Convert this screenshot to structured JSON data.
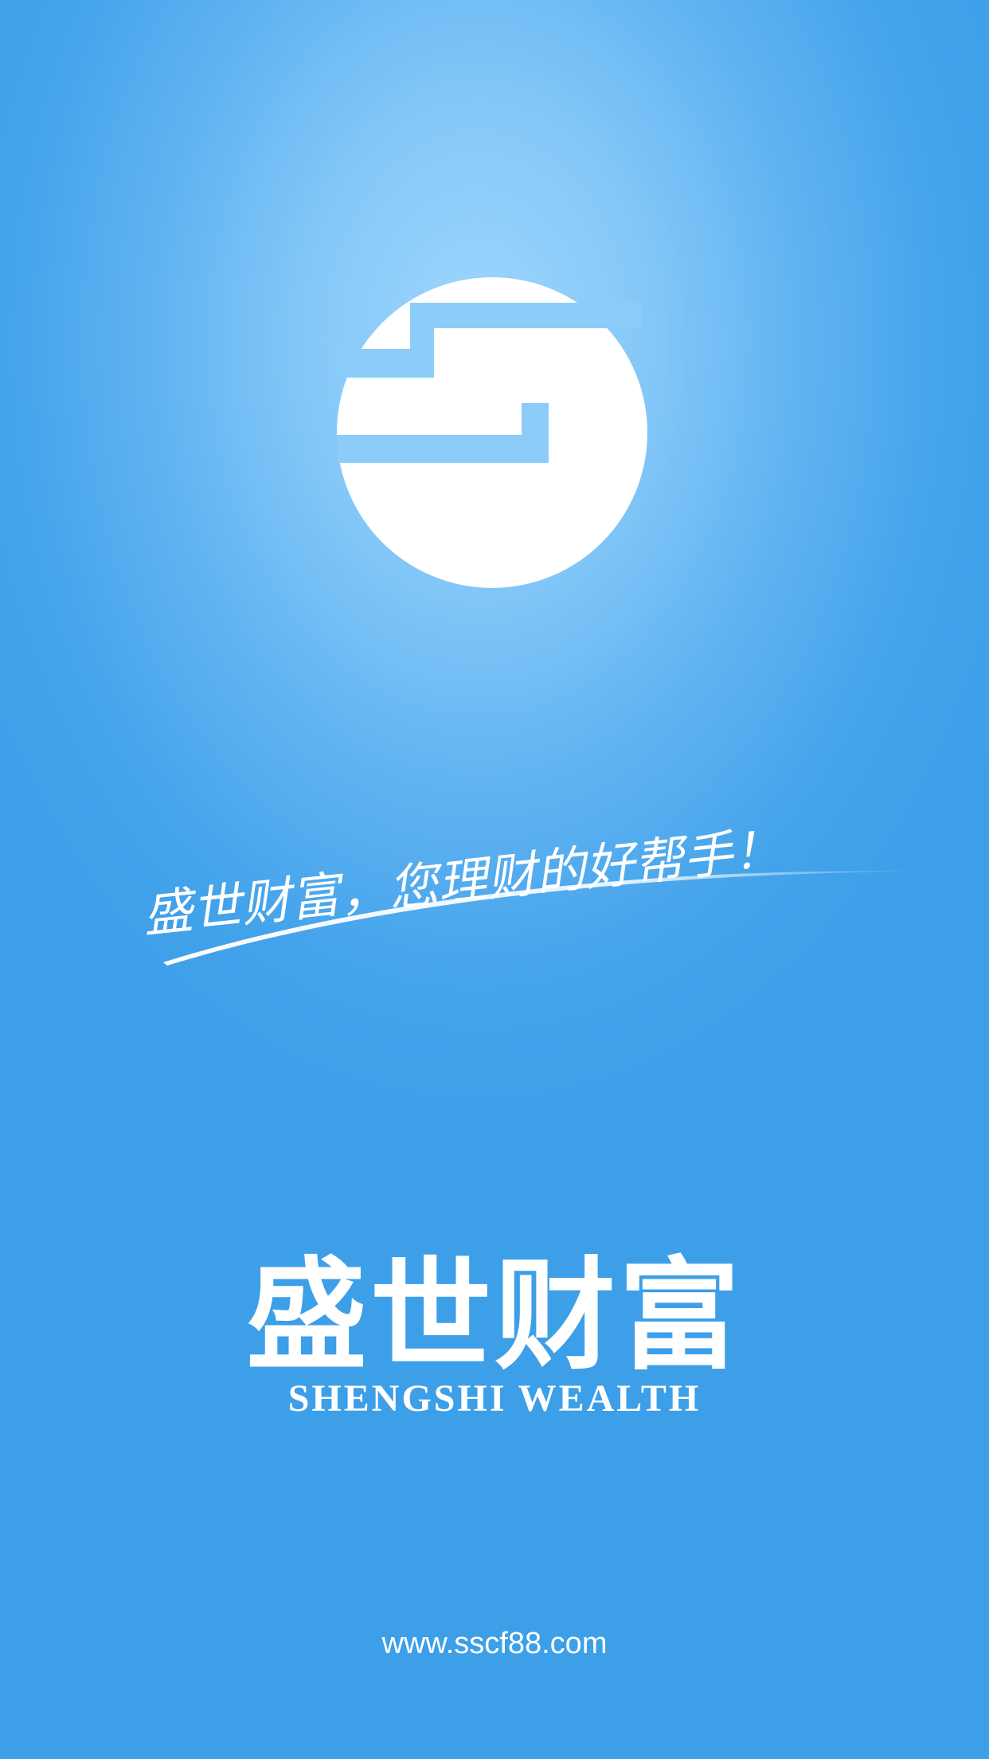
{
  "splash": {
    "logo_icon": "shengshi-s-logo",
    "tagline": "盛世财富，您理财的好帮手！",
    "brand_name_cn": "盛世财富",
    "brand_name_en": "SHENGSHI WEALTH",
    "website": "www.sscf88.com"
  },
  "colors": {
    "background": "#3d9fe8",
    "glow": "#9fd6fd",
    "foreground": "#ffffff"
  }
}
